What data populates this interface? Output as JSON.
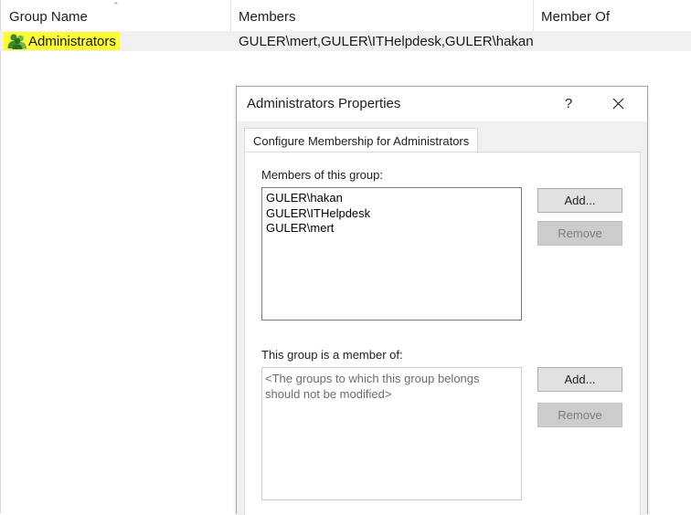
{
  "listview": {
    "columns": [
      "Group Name",
      "Members",
      "Member Of"
    ],
    "rows": [
      {
        "group_name": "Administrators",
        "members": "GULER\\mert,GULER\\ITHelpdesk,GULER\\hakan",
        "member_of": ""
      }
    ]
  },
  "dialog": {
    "title": "Administrators Properties",
    "help_label": "?",
    "tab_label": "Configure Membership for Administrators",
    "members_section": {
      "label": "Members of this group:",
      "items": [
        "GULER\\hakan",
        "GULER\\ITHelpdesk",
        "GULER\\mert"
      ],
      "add_label": "Add...",
      "remove_label": "Remove"
    },
    "member_of_section": {
      "label": "This group is a member of:",
      "placeholder": "<The groups to which this group belongs should not be modified>",
      "add_label": "Add...",
      "remove_label": "Remove"
    }
  },
  "colors": {
    "highlight": "#fbfb3a",
    "row_selected": "#f0f0f0",
    "dialog_bg": "#f0f0f0"
  },
  "icons": [
    "group-icon",
    "sort-ascending-icon",
    "close-icon"
  ]
}
